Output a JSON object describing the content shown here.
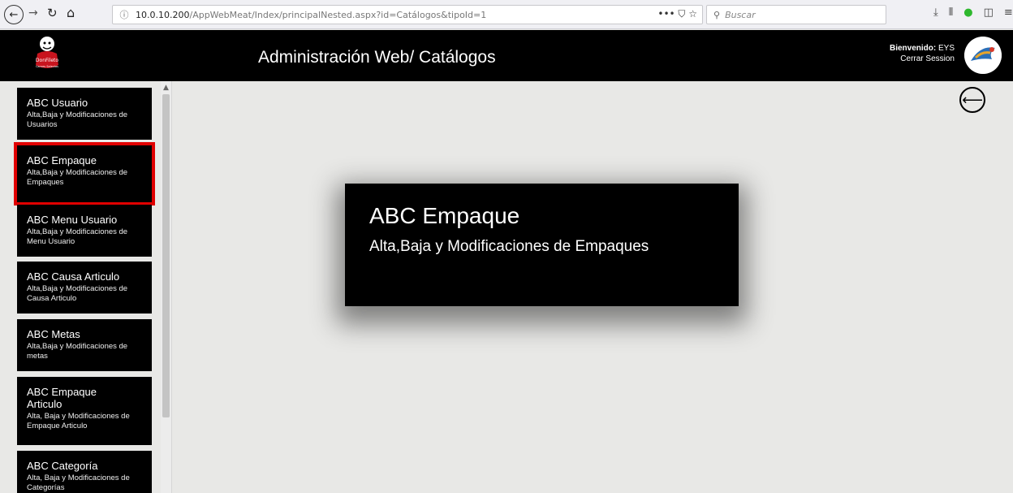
{
  "browser": {
    "url_host": "10.0.10.200",
    "url_path": "/AppWebMeat/Index/principalNested.aspx?id=Catálogos&tipoId=1",
    "url_actions": "••• ⛉ ☆",
    "search_placeholder": "Buscar",
    "toolbar_icons": [
      "download-icon",
      "library-icon",
      "extension-check-icon",
      "sidebar-icon",
      "menu-icon"
    ],
    "glyphs": {
      "back": "←",
      "forward": "→",
      "reload": "↻",
      "home": "⌂",
      "search": "⚲",
      "info": "ⓘ"
    }
  },
  "header": {
    "title": "Administración Web/ Catálogos",
    "welcome_label": "Bienvenido:",
    "user": "EYS",
    "logout": "Cerrar Session",
    "logo_text": "DonFileto",
    "logo_tagline": "Carnes Selectas",
    "background": "#000000"
  },
  "sidebar": {
    "items": [
      {
        "title": "ABC Usuario",
        "desc": "Alta,Baja y Modificaciones de Usuarios"
      },
      {
        "title": "ABC Empaque",
        "desc": "Alta,Baja y Modificaciones de Empaques"
      },
      {
        "title": "ABC Menu Usuario",
        "desc": "Alta,Baja y Modificaciones de Menu Usuario"
      },
      {
        "title": "ABC Causa Articulo",
        "desc": "Alta,Baja y Modificaciones de Causa Articulo"
      },
      {
        "title": "ABC Metas",
        "desc": "Alta,Baja y Modificaciones de metas"
      },
      {
        "title": "ABC Empaque Articulo",
        "desc": "Alta, Baja y Modificaciones de Empaque Articulo"
      },
      {
        "title": "ABC Categoría",
        "desc": "Alta, Baja y Modificaciones de Categorías"
      }
    ],
    "selected_index": 1,
    "highlight_color": "#e00000"
  },
  "main": {
    "back_glyph": "⟵",
    "tooltip": {
      "title": "ABC Empaque",
      "desc": "Alta,Baja y Modificaciones de Empaques"
    }
  }
}
